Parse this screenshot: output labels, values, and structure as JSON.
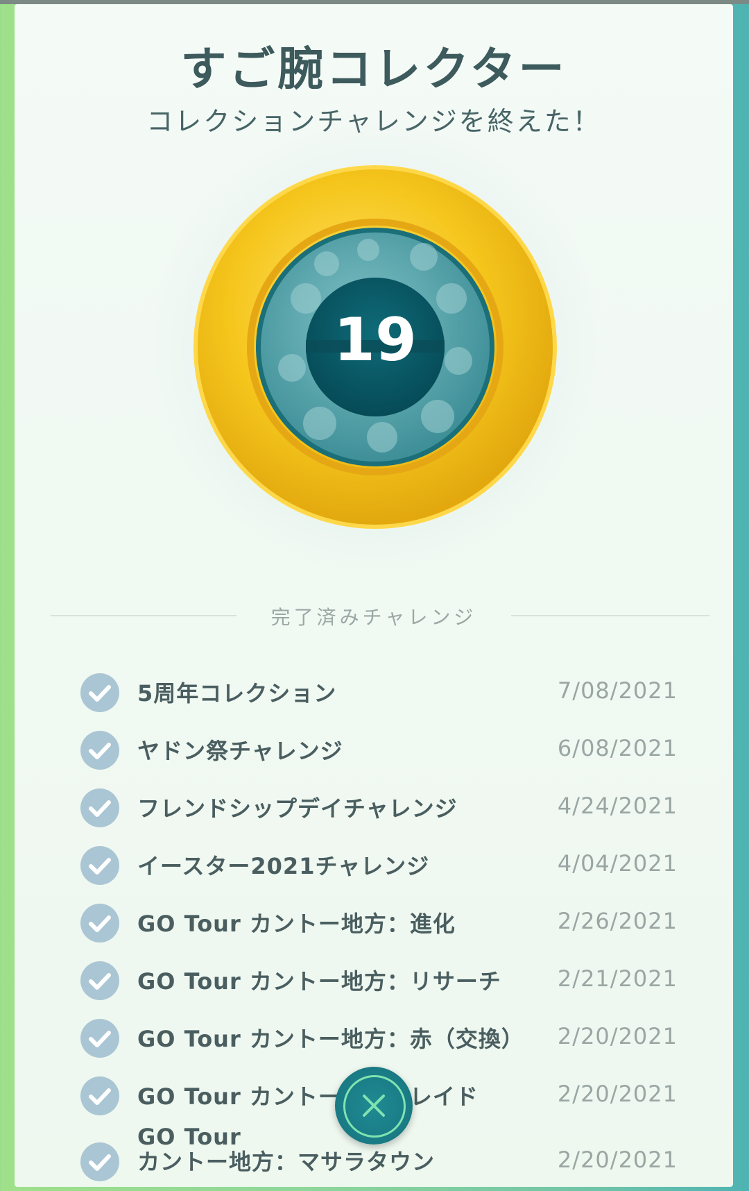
{
  "header": {
    "title": "すご腕コレクター",
    "subtitle": "コレクションチャレンジを終えた！"
  },
  "medal": {
    "count": "19",
    "colors": {
      "gold": "#f2c318",
      "teal": "#2a7d86",
      "center": "#0b5c6a"
    }
  },
  "section": {
    "label": "完了済みチャレンジ"
  },
  "challenges": [
    {
      "name": "5周年コレクション",
      "date": "7/08/2021"
    },
    {
      "name": "ヤドン祭チャレンジ",
      "date": "6/08/2021"
    },
    {
      "name": "フレンドシップデイチャレンジ",
      "date": "4/24/2021"
    },
    {
      "name": "イースター2021チャレンジ",
      "date": "4/04/2021"
    },
    {
      "name": "GO Tour カントー地方：進化",
      "date": "2/26/2021"
    },
    {
      "name": "GO Tour カントー地方：リサーチ",
      "date": "2/21/2021"
    },
    {
      "name": "GO Tour カントー地方：赤（交換）",
      "date": "2/20/2021"
    },
    {
      "name": "GO Tour カントー地方：レイド",
      "date": "2/20/2021"
    },
    {
      "name": "GO Tour\nカントー地方：マサラタウン",
      "date": "2/20/2021"
    }
  ],
  "close_button": {
    "icon": "close-icon"
  }
}
